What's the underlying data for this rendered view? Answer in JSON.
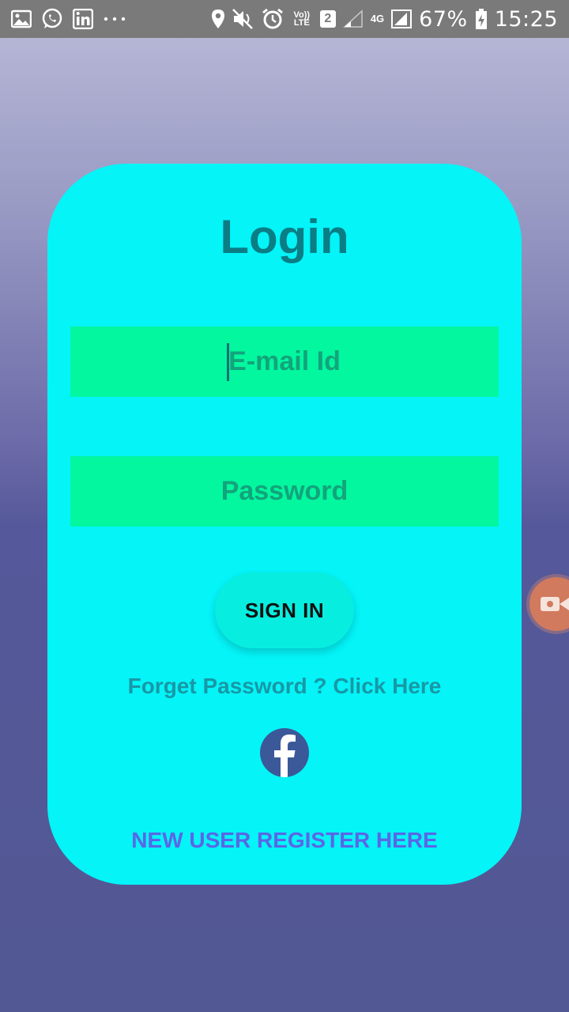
{
  "status_bar": {
    "battery_percent": "67%",
    "time": "15:25",
    "sim_slot": "2",
    "volte_label": "Vo)) LTE",
    "network_label": "4G",
    "icons": [
      "gallery-icon",
      "whatsapp-icon",
      "linkedin-icon",
      "more-dots-icon",
      "location-icon",
      "mute-icon",
      "alarm-icon",
      "volte-icon",
      "sim2-icon",
      "signal-icon",
      "network-4g-icon",
      "signal-icon",
      "battery-charging-icon"
    ]
  },
  "login": {
    "title": "Login",
    "email_placeholder": "E-mail Id",
    "password_placeholder": "Password",
    "signin_label": "SIGN IN",
    "forgot_text": "Forget Password ? Click Here",
    "register_text": "NEW USER REGISTER HERE"
  },
  "colors": {
    "card": "#04f4f8",
    "field": "#03f79f",
    "field_text": "#13a47b",
    "title": "#0b7d85",
    "register": "#5a66e6",
    "facebook": "#3b5998"
  }
}
